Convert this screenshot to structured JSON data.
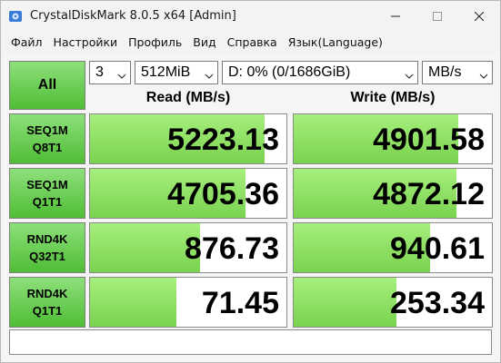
{
  "window": {
    "title": "CrystalDiskMark 8.0.5 x64 [Admin]",
    "icon": "disk-app-icon",
    "buttons": [
      "minimize-icon",
      "maximize-icon",
      "close-icon"
    ]
  },
  "menu": [
    {
      "label": "Файл"
    },
    {
      "label": "Настройки"
    },
    {
      "label": "Профиль"
    },
    {
      "label": "Вид"
    },
    {
      "label": "Справка"
    },
    {
      "label": "Язык(Language)"
    }
  ],
  "controls": {
    "all_label": "All",
    "count": "3",
    "size": "512MiB",
    "drive": "D: 0% (0/1686GiB)",
    "unit": "MB/s"
  },
  "headers": {
    "read": "Read (MB/s)",
    "write": "Write (MB/s)"
  },
  "tests": [
    {
      "line1": "SEQ1M",
      "line2": "Q8T1",
      "read": "5223.13",
      "write": "4901.58",
      "read_fill": 0.89,
      "write_fill": 0.83
    },
    {
      "line1": "SEQ1M",
      "line2": "Q1T1",
      "read": "4705.36",
      "write": "4872.12",
      "read_fill": 0.79,
      "write_fill": 0.82
    },
    {
      "line1": "RND4K",
      "line2": "Q32T1",
      "read": "876.73",
      "write": "940.61",
      "read_fill": 0.56,
      "write_fill": 0.69
    },
    {
      "line1": "RND4K",
      "line2": "Q1T1",
      "read": "71.45",
      "write": "253.34",
      "read_fill": 0.44,
      "write_fill": 0.52
    }
  ],
  "status_text": "",
  "colors": {
    "button_green": "#4fbd36",
    "bar_green": "#7ad24f"
  }
}
